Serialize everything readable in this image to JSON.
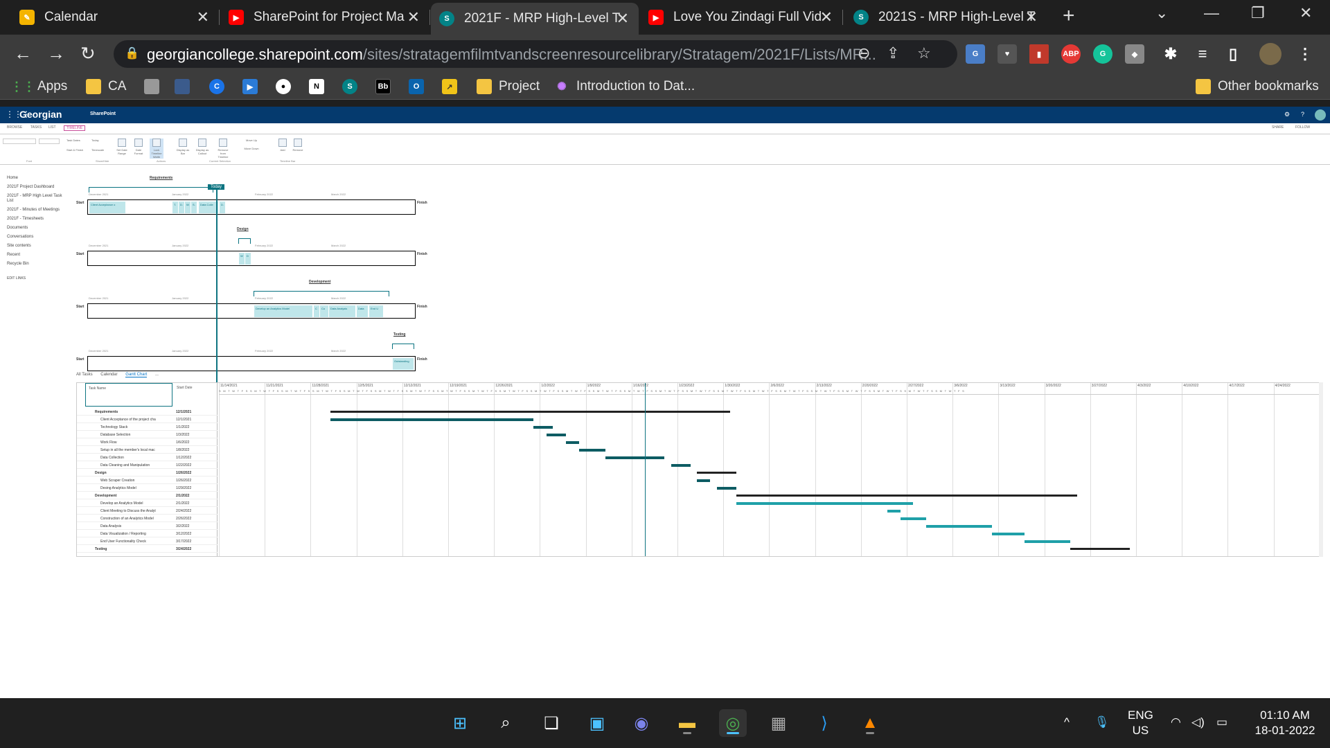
{
  "browser": {
    "tabs": [
      {
        "title": "Calendar",
        "icon": "calendar-icon",
        "color": "#f4b400"
      },
      {
        "title": "SharePoint for Project Ma",
        "icon": "youtube-icon",
        "color": "#ff0000"
      },
      {
        "title": "2021F - MRP High-Level T",
        "icon": "sharepoint-icon",
        "color": "#038387"
      },
      {
        "title": "Love You Zindagi Full Vid",
        "icon": "youtube-icon",
        "color": "#ff0000"
      },
      {
        "title": "2021S - MRP High-Level T",
        "icon": "sharepoint-icon",
        "color": "#038387"
      }
    ],
    "url_host": "georgiancollege.sharepoint.com",
    "url_path": "/sites/stratagemfilmtvandscreenresourcelibrary/Stratagem/2021F/Lists/MR...",
    "bookmarks": [
      {
        "label": "Apps",
        "icon": "apps-icon"
      },
      {
        "label": "CA",
        "icon": "folder-icon"
      },
      {
        "label": "",
        "icon": "notebook-icon"
      },
      {
        "label": "",
        "icon": "doc-icon"
      },
      {
        "label": "",
        "icon": "c-icon"
      },
      {
        "label": "",
        "icon": "video-icon"
      },
      {
        "label": "",
        "icon": "github-icon"
      },
      {
        "label": "",
        "icon": "notion-icon"
      },
      {
        "label": "",
        "icon": "sharepoint-icon"
      },
      {
        "label": "",
        "icon": "bb-icon"
      },
      {
        "label": "",
        "icon": "outlook-icon"
      },
      {
        "label": "",
        "icon": "chart-icon"
      },
      {
        "label": "Project",
        "icon": "folder-icon"
      },
      {
        "label": "Introduction to Dat...",
        "icon": "course-icon"
      }
    ],
    "other_bookmarks": "Other bookmarks",
    "apps_label": "Apps",
    "ca_label": "CA",
    "bb_label": "Bb",
    "project_label": "Project",
    "intro_label": "Introduction to Dat...",
    "abp_label": "ABP"
  },
  "sharepoint": {
    "brand": "Georgian",
    "product": "SharePoint",
    "ribbon_tabs": [
      "BROWSE",
      "TASKS",
      "LIST",
      "TIMELINE"
    ],
    "share": "SHARE",
    "follow": "FOLLOW",
    "ribbon_buttons": [
      "Task Dates",
      "Today",
      "Start & Finish",
      "Timescale",
      "Set Date Range",
      "Date Format",
      "Lock Timeline Width",
      "Display as Bar",
      "Display as Callout",
      "Remove from Timeline",
      "Move Up",
      "Move Down",
      "Add",
      "Remove"
    ],
    "ribbon_groups": [
      "Font",
      "Show/Hide",
      "Actions",
      "Current Selection",
      "Timeline Bar"
    ],
    "left_nav": [
      "Home",
      "2021F Project Dashboard",
      "2021F - MRP High Level Task List",
      "2021F - Minutes of Meetings",
      "2021F - Timesheets",
      "Documents",
      "Conversations",
      "Site contents",
      "Recent",
      "Recycle Bin",
      "EDIT LINKS"
    ],
    "today_label": "Today",
    "start_label": "Start",
    "finish_label": "Finish",
    "month_labels": [
      "December 2021",
      "January 2022",
      "February 2022",
      "March 2022"
    ],
    "phases": [
      {
        "title": "Requirements",
        "blocks": [
          "Client Acceptance o",
          "T.",
          "D.",
          "W.",
          "S.",
          "Data Colle",
          "D."
        ]
      },
      {
        "title": "Design",
        "blocks": [
          "W",
          "D"
        ]
      },
      {
        "title": "Development",
        "blocks": [
          "Develop an Analytics Model",
          "C",
          "Co",
          "Data Analysis",
          "Data",
          "End U"
        ]
      },
      {
        "title": "Testing",
        "blocks": [
          "Outstanding"
        ]
      }
    ],
    "view_tabs": [
      "All Tasks",
      "Calendar",
      "Gantt Chart",
      "..."
    ],
    "grid_headers": {
      "name": "Task Name",
      "start": "Start Date"
    },
    "tasks": [
      {
        "name": "Requirements",
        "start": "12/1/2021",
        "summary": true
      },
      {
        "name": "Client Acceptance of the project cha",
        "start": "12/1/2021",
        "summary": false
      },
      {
        "name": "Technology Stack",
        "start": "1/1/2022",
        "summary": false
      },
      {
        "name": "Database Selection",
        "start": "1/3/2022",
        "summary": false
      },
      {
        "name": "Work Flow",
        "start": "1/6/2022",
        "summary": false
      },
      {
        "name": "Setup in all the member's local mac",
        "start": "1/8/2022",
        "summary": false
      },
      {
        "name": "Data Collection",
        "start": "1/12/2022",
        "summary": false
      },
      {
        "name": "Data Cleaning and Manipulation",
        "start": "1/22/2022",
        "summary": false
      },
      {
        "name": "Design",
        "start": "1/26/2022",
        "summary": true
      },
      {
        "name": "Web Scraper Creation",
        "start": "1/26/2022",
        "summary": false
      },
      {
        "name": "Desing Analytics Model",
        "start": "1/29/2022",
        "summary": false
      },
      {
        "name": "Development",
        "start": "2/1/2022",
        "summary": true
      },
      {
        "name": "Develop an Analytics Model",
        "start": "2/1/2022",
        "summary": false
      },
      {
        "name": "Client Meeting to Discuss the Analyt",
        "start": "2/24/2022",
        "summary": false
      },
      {
        "name": "Construction of an Analytics Model",
        "start": "2/26/2022",
        "summary": false
      },
      {
        "name": "Data Analysis",
        "start": "3/2/2022",
        "summary": false
      },
      {
        "name": "Data Visualization / Reporting",
        "start": "3/12/2022",
        "summary": false
      },
      {
        "name": "End User Functionality Check",
        "start": "3/17/2022",
        "summary": false
      },
      {
        "name": "Testing",
        "start": "3/24/2022",
        "summary": true
      }
    ],
    "gantt_weeks": [
      "11/14/2021",
      "11/21/2021",
      "11/28/2021",
      "12/5/2021",
      "12/12/2021",
      "12/19/2021",
      "12/26/2021",
      "1/2/2022",
      "1/9/2022",
      "1/16/2022",
      "1/23/2022",
      "1/30/2022",
      "2/6/2022",
      "2/13/2022",
      "2/20/2022",
      "2/27/2022",
      "3/6/2022",
      "3/13/2022",
      "3/20/2022",
      "3/27/2022",
      "4/3/2022",
      "4/10/2022",
      "4/17/2022",
      "4/24/2022"
    ],
    "day_letters": "SMTWTFS"
  },
  "taskbar": {
    "lang": "ENG",
    "region": "US",
    "time": "01:10 AM",
    "date": "18-01-2022"
  }
}
